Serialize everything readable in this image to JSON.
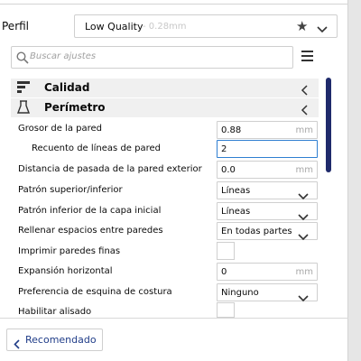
{
  "profile": {
    "label": "Perfil",
    "name": "Low Quality",
    "sub": "- 0.28mm"
  },
  "search": {
    "placeholder": "Buscar ajustes"
  },
  "categories": [
    {
      "label": "Calidad",
      "icon": "quality-icon"
    },
    {
      "label": "Perímetro",
      "icon": "perimeter-icon"
    }
  ],
  "settings": [
    {
      "label": "Grosor de la pared",
      "value": "0.88",
      "unit": "mm",
      "type": "number"
    },
    {
      "label": "Recuento de líneas de pared",
      "value": "2",
      "unit": "",
      "type": "number",
      "active": true
    },
    {
      "label": "Distancia de pasada de la pared exterior",
      "value": "0.0",
      "unit": "mm",
      "type": "number"
    },
    {
      "label": "Patrón superior/inferior",
      "value": "Líneas",
      "type": "select"
    },
    {
      "label": "Patrón inferior de la capa inicial",
      "value": "Líneas",
      "type": "select"
    },
    {
      "label": "Rellenar espacios entre paredes",
      "value": "En todas partes",
      "type": "select"
    },
    {
      "label": "Imprimir paredes finas",
      "type": "checkbox",
      "checked": false
    },
    {
      "label": "Expansión horizontal",
      "value": "0",
      "unit": "mm",
      "type": "number"
    },
    {
      "label": "Preferencia de esquina de costura",
      "value": "Ninguno",
      "type": "select"
    },
    {
      "label": "Habilitar alisado",
      "type": "checkbox",
      "checked": false
    }
  ],
  "footer": {
    "recommended_label": "Recomendado"
  },
  "colors": {
    "accent": "#2f7fd1",
    "scrollbar": "#1f2a6b",
    "link": "#1f3c88"
  }
}
